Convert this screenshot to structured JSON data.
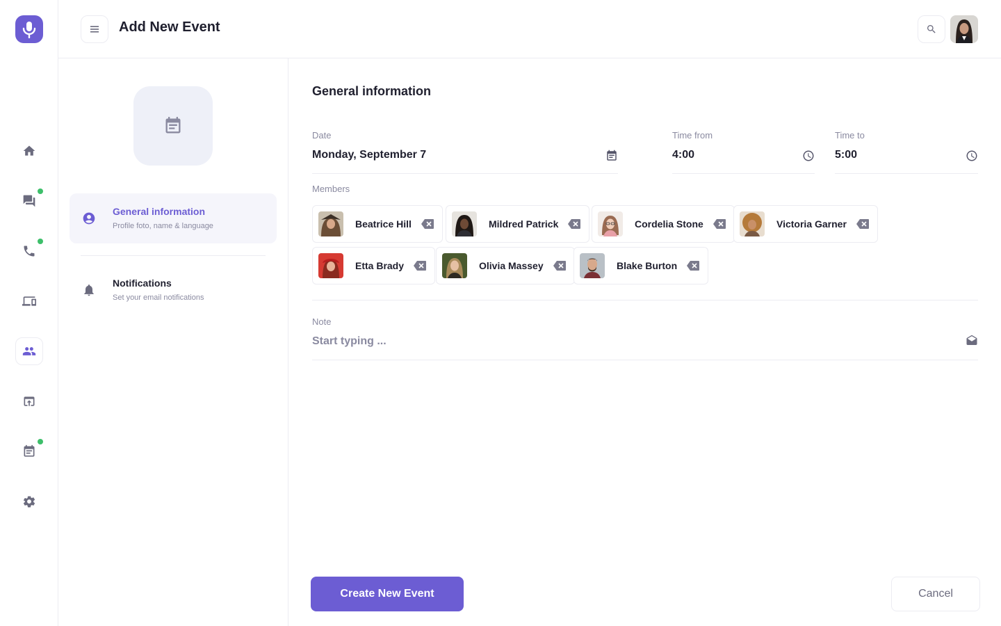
{
  "header": {
    "title": "Add New Event"
  },
  "icons": {
    "logo": "microphone-icon",
    "menu": "hamburger-icon",
    "search": "search-icon"
  },
  "nav": {
    "items": [
      {
        "name": "home-icon",
        "active": false,
        "badge": false
      },
      {
        "name": "chat-icon",
        "active": false,
        "badge": true
      },
      {
        "name": "phone-icon",
        "active": false,
        "badge": true
      },
      {
        "name": "devices-icon",
        "active": false,
        "badge": false
      },
      {
        "name": "contacts-icon",
        "active": true,
        "badge": false
      },
      {
        "name": "upload-icon",
        "active": false,
        "badge": false
      },
      {
        "name": "calendar-icon",
        "active": false,
        "badge": true
      },
      {
        "name": "settings-icon",
        "active": false,
        "badge": false
      }
    ]
  },
  "side": {
    "items": [
      {
        "title": "General information",
        "subtitle": "Profile foto, name & language",
        "active": true
      },
      {
        "title": "Notifications",
        "subtitle": "Set your email notifications",
        "active": false
      }
    ]
  },
  "form": {
    "section_title": "General information",
    "date": {
      "label": "Date",
      "value": "Monday, September 7"
    },
    "time_from": {
      "label": "Time from",
      "value": "4:00"
    },
    "time_to": {
      "label": "Time to",
      "value": "5:00"
    },
    "members_label": "Members",
    "members": [
      {
        "name": "Beatrice Hill",
        "color": "#8a6b4f"
      },
      {
        "name": "Mildred Patrick",
        "color": "#3a2a24"
      },
      {
        "name": "Cordelia Stone",
        "color": "#d9b9a8"
      },
      {
        "name": "Victoria Garner",
        "color": "#c48a4a"
      },
      {
        "name": "Etta Brady",
        "color": "#c8302c"
      },
      {
        "name": "Olivia Massey",
        "color": "#6e6a3a"
      },
      {
        "name": "Blake Burton",
        "color": "#5b6670"
      }
    ],
    "note": {
      "label": "Note",
      "value": "",
      "placeholder": "Start typing ..."
    },
    "create_label": "Create New Event",
    "cancel_label": "Cancel"
  },
  "colors": {
    "accent": "#6c5dd3",
    "badge": "#3dbf6a",
    "border": "#ececf2",
    "muted": "#8a8aa0"
  }
}
